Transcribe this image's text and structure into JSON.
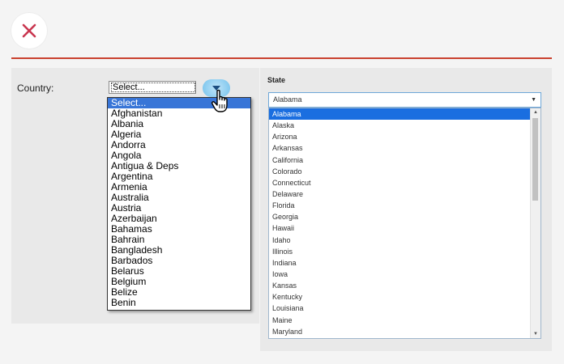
{
  "close_button": {
    "icon": "close-icon",
    "color": "#c9364f"
  },
  "divider_color": "#c9412f",
  "country": {
    "label": "Country:",
    "selected_value": "Select...",
    "options": [
      "Select...",
      "Afghanistan",
      "Albania",
      "Algeria",
      "Andorra",
      "Angola",
      "Antigua & Deps",
      "Argentina",
      "Armenia",
      "Australia",
      "Austria",
      "Azerbaijan",
      "Bahamas",
      "Bahrain",
      "Bangladesh",
      "Barbados",
      "Belarus",
      "Belgium",
      "Belize",
      "Benin"
    ],
    "highlighted_index": 0,
    "highlight_color": "#3875d7"
  },
  "state": {
    "label": "State",
    "selected_value": "Alabama",
    "options": [
      "Alabama",
      "Alaska",
      "Arizona",
      "Arkansas",
      "California",
      "Colorado",
      "Connecticut",
      "Delaware",
      "Florida",
      "Georgia",
      "Hawaii",
      "Idaho",
      "Illinois",
      "Indiana",
      "Iowa",
      "Kansas",
      "Kentucky",
      "Louisiana",
      "Maine",
      "Maryland"
    ],
    "highlighted_index": 0,
    "highlight_color": "#1a6ee0"
  }
}
